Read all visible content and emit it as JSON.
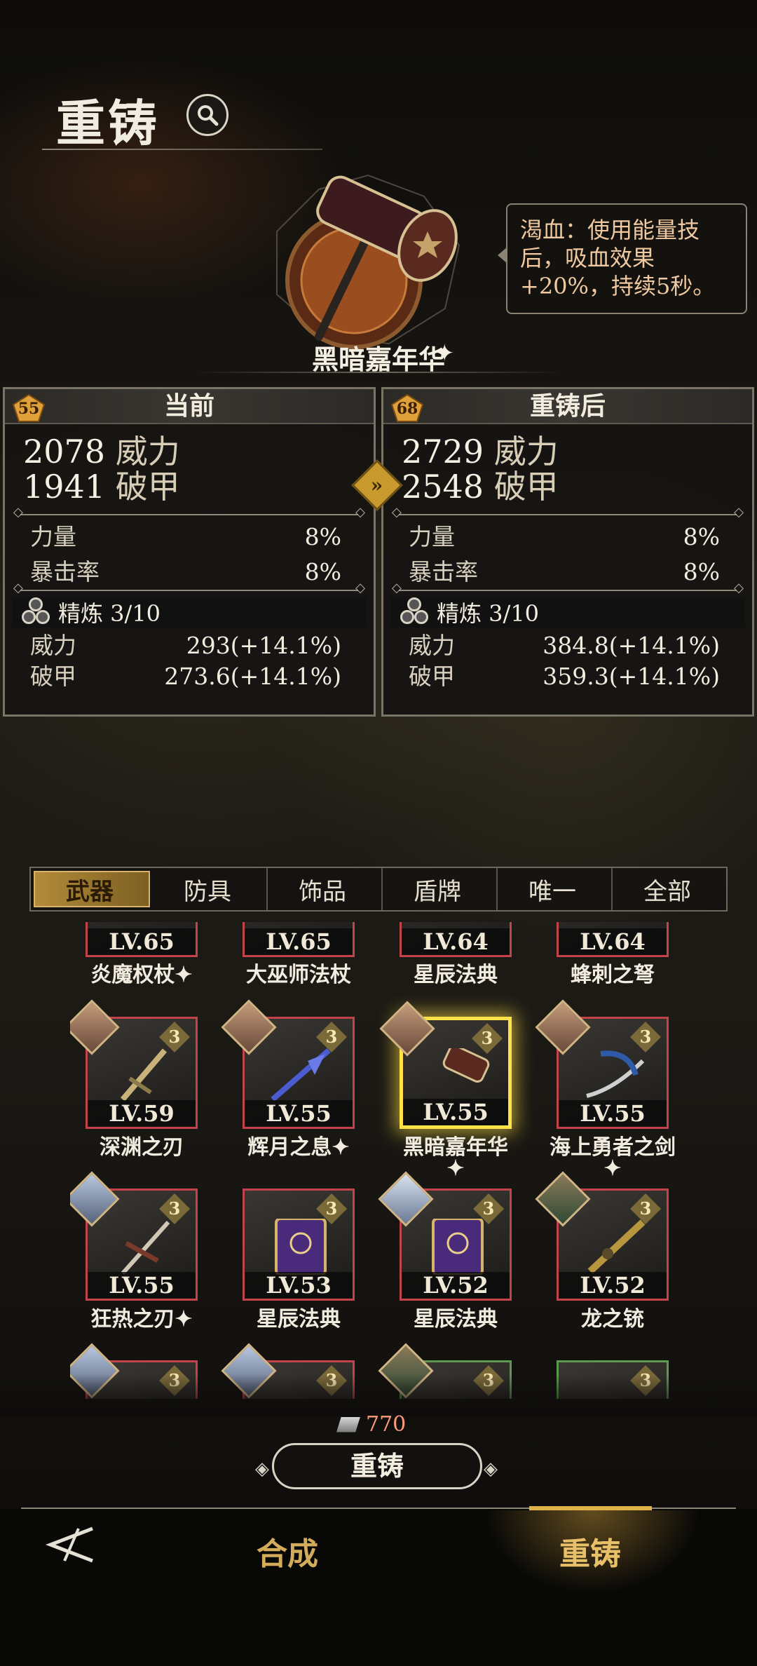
{
  "header": {
    "title": "重铸"
  },
  "featured": {
    "name": "黑暗嘉年华",
    "tooltip": "渴血：使用能量技后，吸血效果+20%，持续5秒。"
  },
  "current": {
    "label": "当前",
    "level": "55",
    "power": "2078",
    "armor_break": "1941",
    "power_label": "威力",
    "armor_label": "破甲",
    "stats": [
      {
        "name": "力量",
        "value": "8%"
      },
      {
        "name": "暴击率",
        "value": "8%"
      }
    ],
    "refine": "精炼 3/10",
    "refine_stats": [
      {
        "name": "威力",
        "value": "293(+14.1%)"
      },
      {
        "name": "破甲",
        "value": "273.6(+14.1%)"
      }
    ]
  },
  "after": {
    "label": "重铸后",
    "level": "68",
    "power": "2729",
    "armor_break": "2548",
    "power_label": "威力",
    "armor_label": "破甲",
    "stats": [
      {
        "name": "力量",
        "value": "8%"
      },
      {
        "name": "暴击率",
        "value": "8%"
      }
    ],
    "refine": "精炼 3/10",
    "refine_stats": [
      {
        "name": "威力",
        "value": "384.8(+14.1%)"
      },
      {
        "name": "破甲",
        "value": "359.3(+14.1%)"
      }
    ]
  },
  "tabs": [
    "武器",
    "防具",
    "饰品",
    "盾牌",
    "唯一",
    "全部"
  ],
  "items_row0": [
    {
      "lv": "LV.65",
      "name": "炎魔权杖✦"
    },
    {
      "lv": "LV.65",
      "name": "大巫师法杖"
    },
    {
      "lv": "LV.64",
      "name": "星辰法典"
    },
    {
      "lv": "LV.64",
      "name": "蜂刺之弩"
    }
  ],
  "items_row1": [
    {
      "lv": "LV.59",
      "name": "深渊之刃",
      "stars": "3"
    },
    {
      "lv": "LV.55",
      "name": "辉月之息✦",
      "stars": "3"
    },
    {
      "lv": "LV.55",
      "name": "黑暗嘉年华",
      "stars": "3"
    },
    {
      "lv": "LV.55",
      "name": "海上勇者之剑",
      "stars": "3"
    }
  ],
  "items_row2": [
    {
      "lv": "LV.55",
      "name": "狂热之刃✦",
      "stars": "3"
    },
    {
      "lv": "LV.53",
      "name": "星辰法典",
      "stars": "3"
    },
    {
      "lv": "LV.52",
      "name": "星辰法典",
      "stars": "3"
    },
    {
      "lv": "LV.52",
      "name": "龙之铳",
      "stars": "3"
    }
  ],
  "items_row3": [
    {
      "stars": "3"
    },
    {
      "stars": "3"
    },
    {
      "stars": "3"
    },
    {
      "stars": "3"
    }
  ],
  "currency": {
    "amount": "770"
  },
  "actions": {
    "reforge": "重铸"
  },
  "nav": {
    "compose": "合成",
    "reforge": "重铸"
  },
  "colors": {
    "accent_gold": "#e0b34a",
    "selected": "#ffe14a",
    "rarity_red": "#c4434a",
    "rarity_green": "#5c9a4e"
  }
}
